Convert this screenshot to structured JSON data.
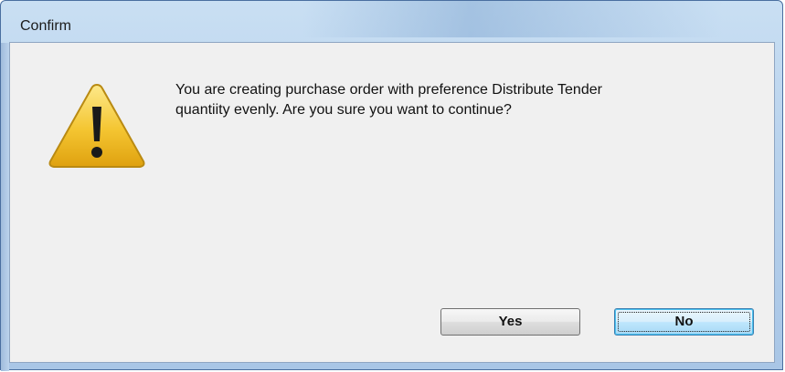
{
  "dialog": {
    "title": "Confirm",
    "icon": "warning-icon",
    "message_lines": [
      "You are creating purchase order with preference Distribute Tender",
      "quantiity evenly. Are you sure you want to continue?"
    ],
    "buttons": {
      "yes_label": "Yes",
      "no_label": "No",
      "default_button": "No"
    }
  },
  "colors": {
    "frame": "#b7d1ec",
    "client_background": "#f0f0f0",
    "warning_yellow": "#f2c230",
    "focus_blue": "#3c7fb1"
  }
}
